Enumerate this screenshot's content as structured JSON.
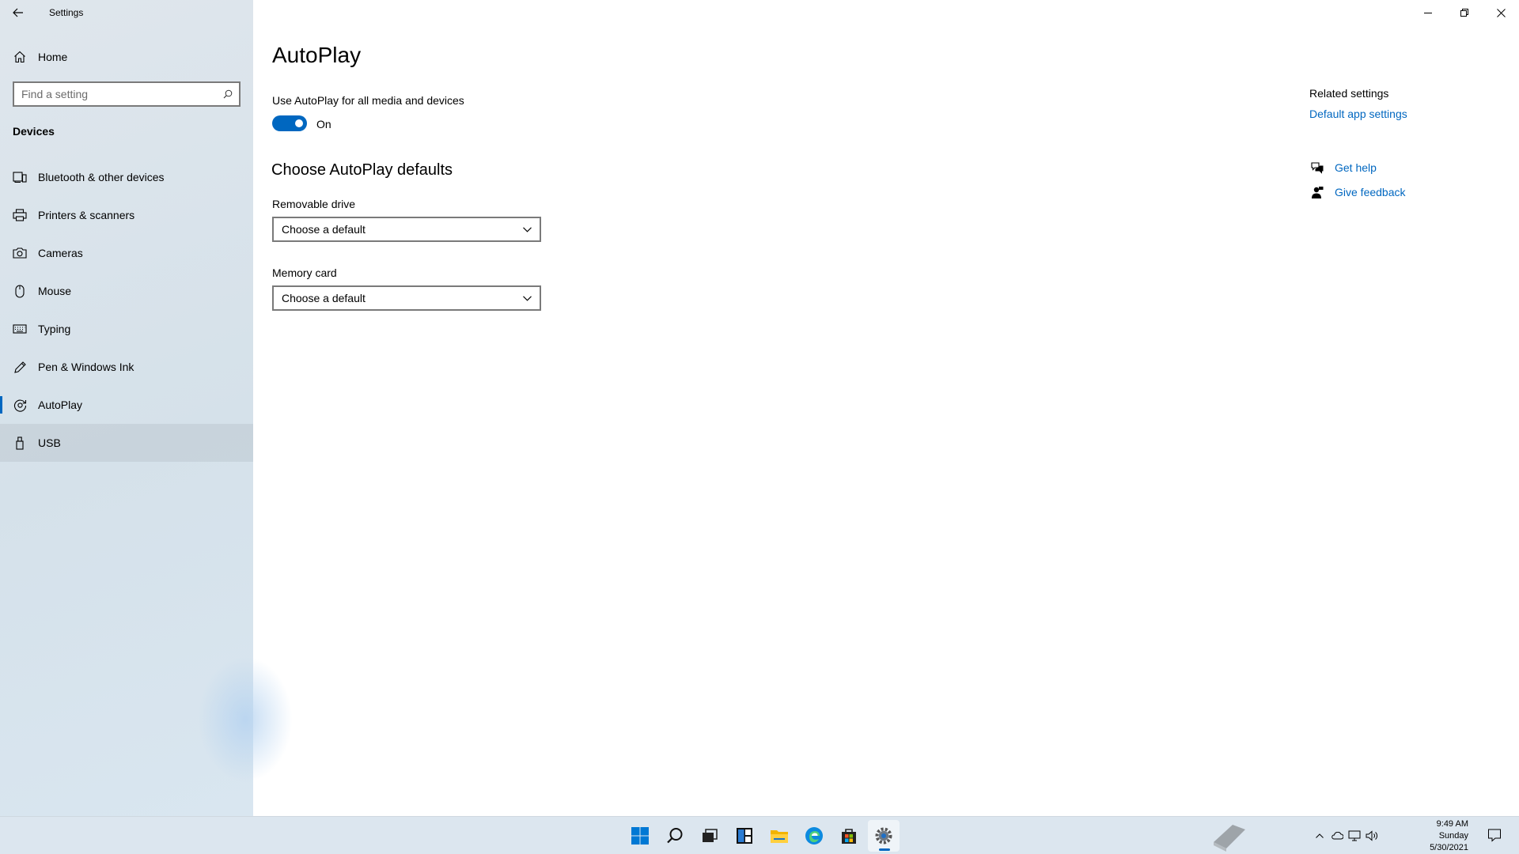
{
  "window": {
    "title": "Settings"
  },
  "sidebar": {
    "home_label": "Home",
    "search_placeholder": "Find a setting",
    "section": "Devices",
    "items": [
      {
        "label": "Bluetooth & other devices",
        "icon": "bluetooth-devices-icon"
      },
      {
        "label": "Printers & scanners",
        "icon": "printer-icon"
      },
      {
        "label": "Cameras",
        "icon": "camera-icon"
      },
      {
        "label": "Mouse",
        "icon": "mouse-icon"
      },
      {
        "label": "Typing",
        "icon": "keyboard-icon"
      },
      {
        "label": "Pen & Windows Ink",
        "icon": "pen-icon"
      },
      {
        "label": "AutoPlay",
        "icon": "autoplay-icon",
        "selected": true
      },
      {
        "label": "USB",
        "icon": "usb-icon",
        "hovered": true
      }
    ]
  },
  "main": {
    "title": "AutoPlay",
    "toggle_label": "Use AutoPlay for all media and devices",
    "toggle_state": "On",
    "toggle_on": true,
    "defaults_title": "Choose AutoPlay defaults",
    "removable_label": "Removable drive",
    "removable_value": "Choose a default",
    "memory_label": "Memory card",
    "memory_value": "Choose a default"
  },
  "related": {
    "heading": "Related settings",
    "default_apps_link": "Default app settings",
    "get_help": "Get help",
    "give_feedback": "Give feedback"
  },
  "taskbar": {
    "apps": [
      "start-icon",
      "search-icon",
      "task-view-icon",
      "widgets-icon",
      "file-explorer-icon",
      "edge-icon",
      "store-icon",
      "settings-icon"
    ],
    "active_app": "settings-icon",
    "time": "9:49 AM",
    "day": "Sunday",
    "date": "5/30/2021"
  },
  "colors": {
    "accent": "#0067c0",
    "sidebar_bg": "#dfe6ec",
    "taskbar_bg": "#dce6ef"
  }
}
